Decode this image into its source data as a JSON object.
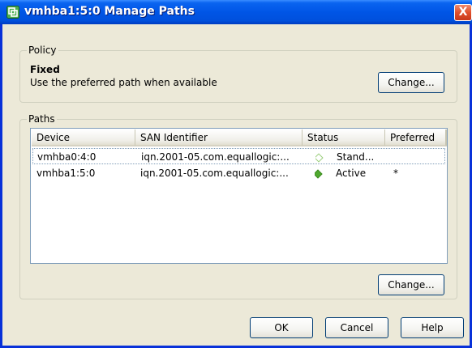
{
  "window": {
    "title": "vmhba1:5:0 Manage Paths",
    "close_label": "X"
  },
  "policy": {
    "group_label": "Policy",
    "name": "Fixed",
    "description": "Use the preferred path when available",
    "change_label": "Change..."
  },
  "paths": {
    "group_label": "Paths",
    "columns": [
      "Device",
      "SAN Identifier",
      "Status",
      "Preferred"
    ],
    "rows": [
      {
        "device": "vmhba0:4:0",
        "san": "iqn.2001-05.com.equallogic:...",
        "status_icon": "standby-diamond-icon",
        "status": "Stand...",
        "preferred": ""
      },
      {
        "device": "vmhba1:5:0",
        "san": "iqn.2001-05.com.equallogic:...",
        "status_icon": "active-diamond-icon",
        "status": "Active",
        "preferred": "*"
      }
    ],
    "change_label": "Change..."
  },
  "footer": {
    "ok_label": "OK",
    "cancel_label": "Cancel",
    "help_label": "Help"
  },
  "colors": {
    "titlebar": "#0055E6",
    "active_status": "#4FA82F",
    "standby_status": "#9ACD7A"
  }
}
